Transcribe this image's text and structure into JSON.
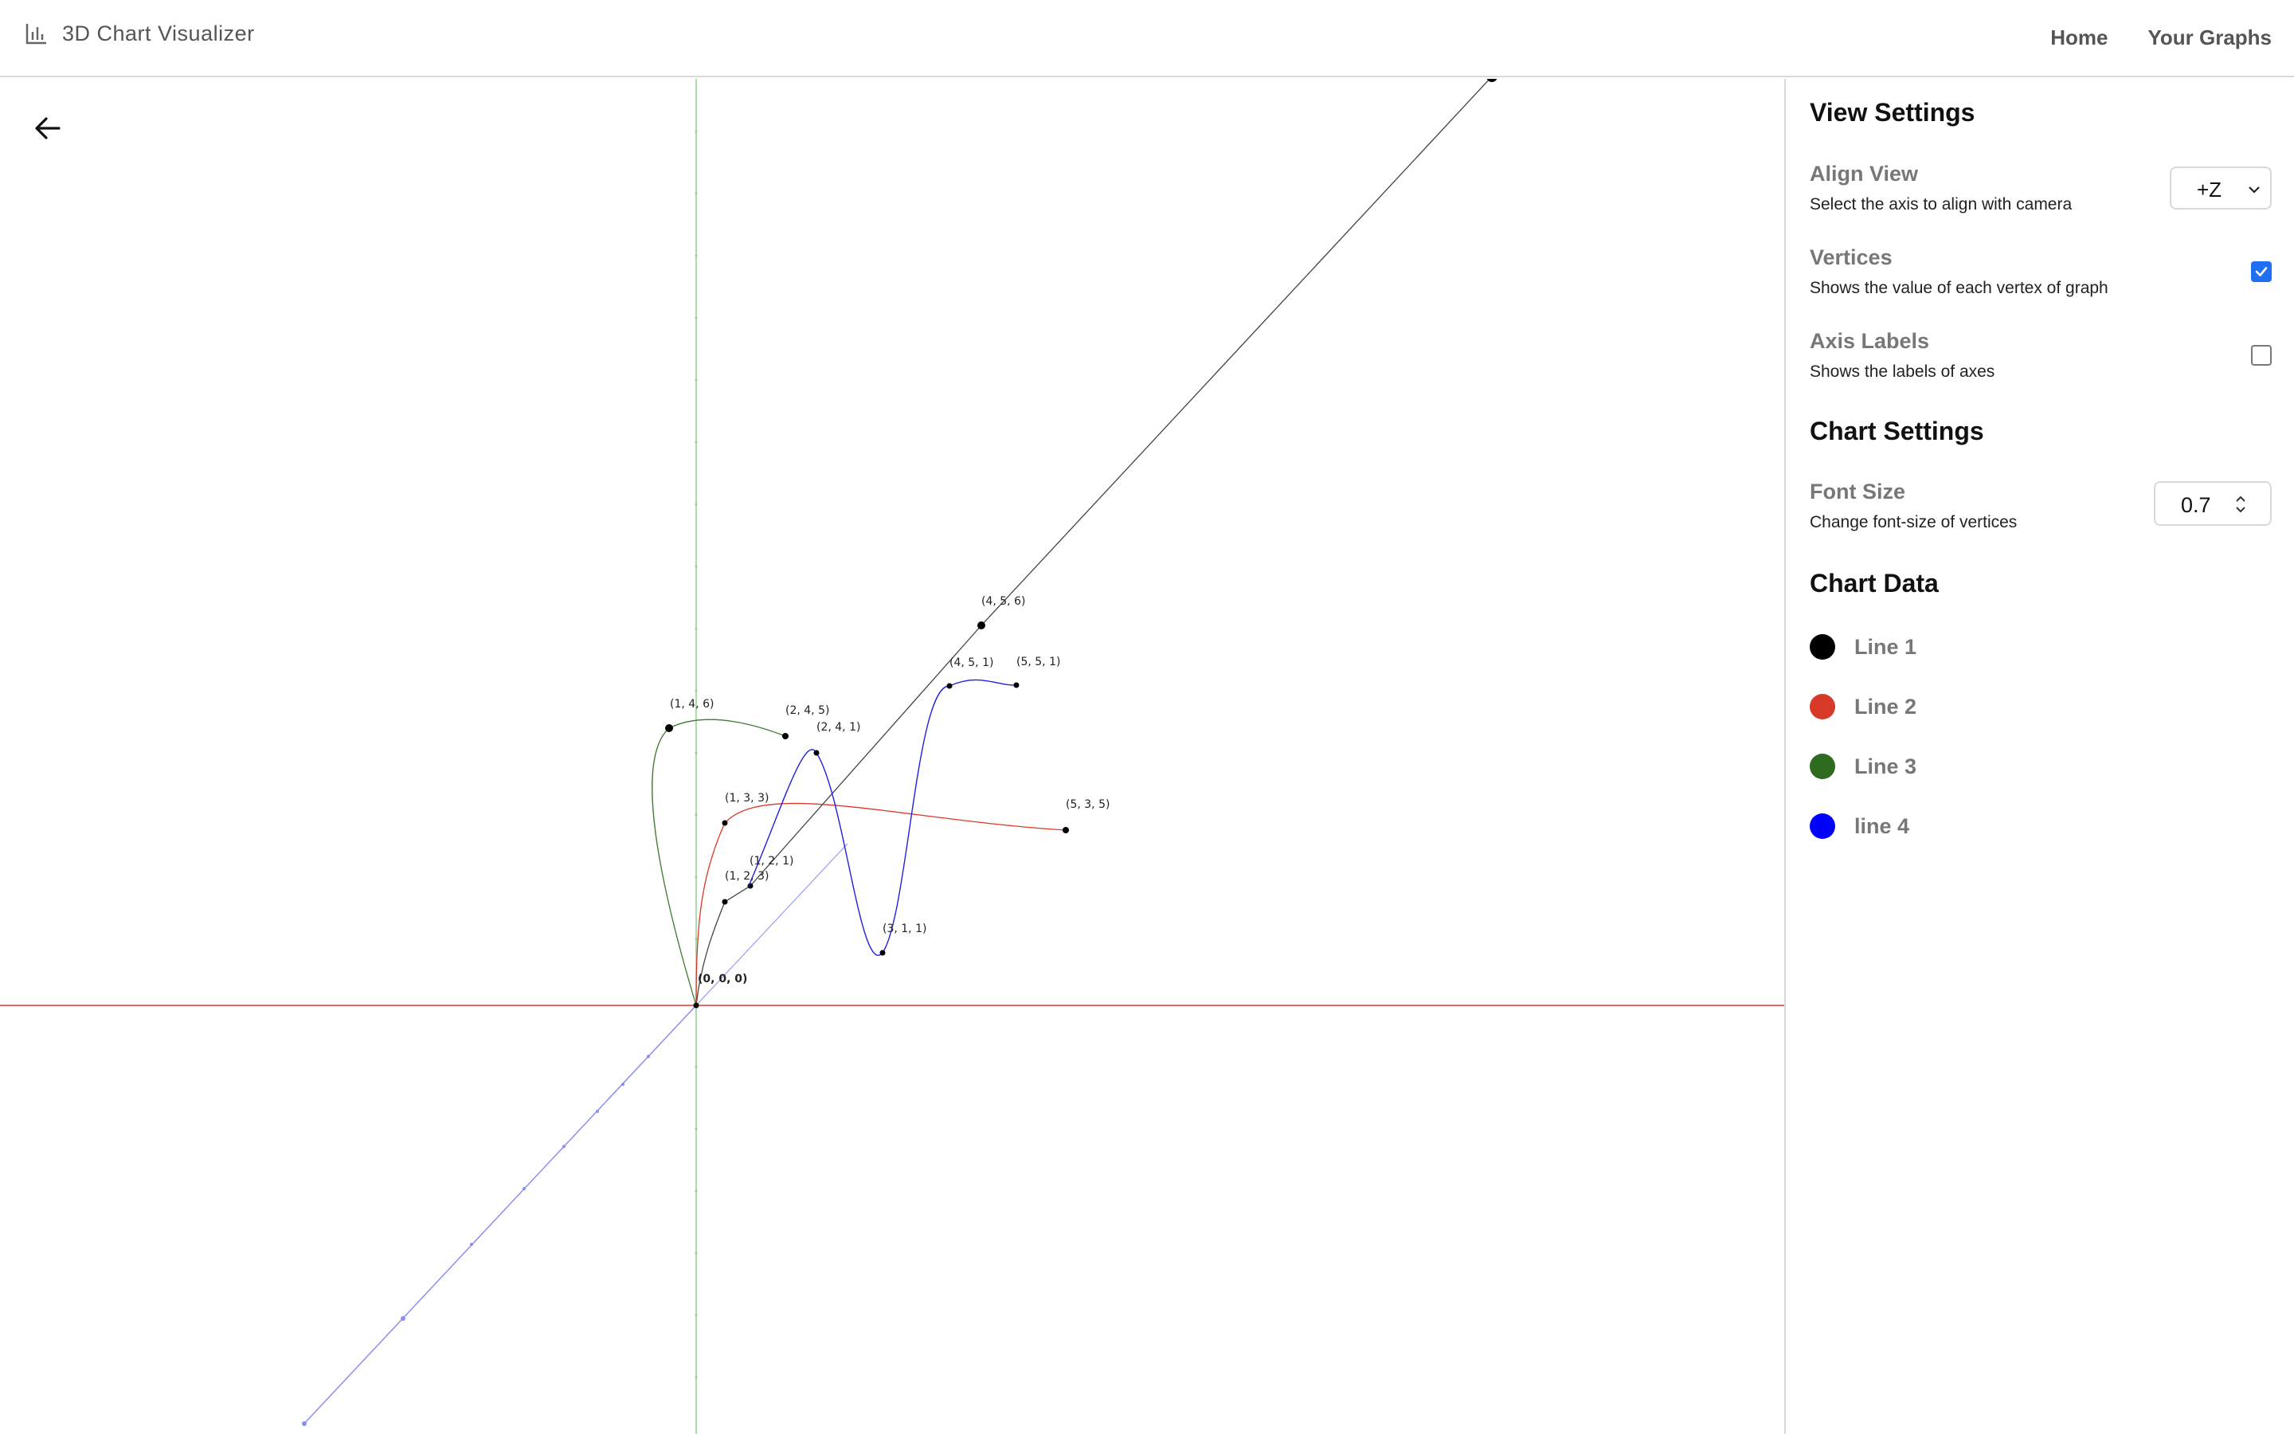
{
  "header": {
    "brand_icon": "bar-chart-icon",
    "title": "3D Chart Visualizer",
    "nav": [
      {
        "label": "Home"
      },
      {
        "label": "Your Graphs"
      }
    ]
  },
  "canvas": {
    "back_icon": "arrow-left-icon",
    "origin_label": "(0, 0, 0)",
    "vertex_labels": [
      "(4, 5, 6)",
      "(4, 5, 1)",
      "(5, 5, 1)",
      "(1, 4, 6)",
      "(2, 4, 5)",
      "(2, 4, 1)",
      "(1, 3, 3)",
      "(5, 3, 5)",
      "(1, 2, 1)",
      "(1, 2, 3)",
      "(3, 1, 1)"
    ]
  },
  "sidebar": {
    "view_settings": {
      "title": "View Settings",
      "align_view": {
        "label": "Align View",
        "desc": "Select the axis to align with camera",
        "value": "+Z"
      },
      "vertices": {
        "label": "Vertices",
        "desc": "Shows the value of each vertex of graph",
        "checked": true
      },
      "axis_labels": {
        "label": "Axis Labels",
        "desc": "Shows the labels of axes",
        "checked": false
      }
    },
    "chart_settings": {
      "title": "Chart Settings",
      "font_size": {
        "label": "Font Size",
        "desc": "Change font-size of vertices",
        "value": "0.7"
      }
    },
    "chart_data": {
      "title": "Chart Data",
      "series": [
        {
          "name": "Line 1",
          "color": "#000000"
        },
        {
          "name": "Line 2",
          "color": "#d83a2a"
        },
        {
          "name": "Line 3",
          "color": "#2e6b1f"
        },
        {
          "name": "line 4",
          "color": "#0000ff"
        }
      ]
    }
  },
  "colors": {
    "x_axis": "#d33b3b",
    "y_axis": "#8fd28f",
    "z_axis": "#8a8ff0",
    "checkbox_accent": "#1f6ff2"
  }
}
